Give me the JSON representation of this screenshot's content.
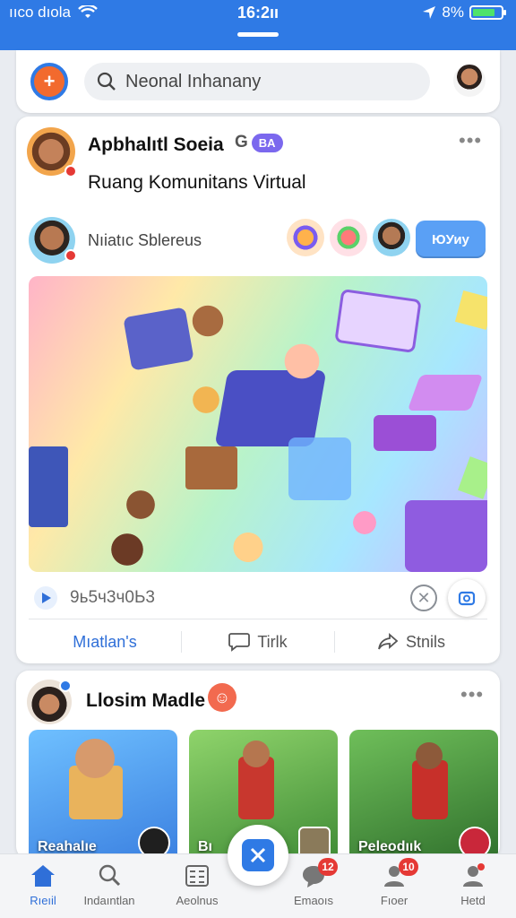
{
  "status_bar": {
    "carrier": "ııco dıola",
    "time": "16:2ıı",
    "battery": "8%"
  },
  "search": {
    "placeholder": "Neonal Inhanany"
  },
  "post": {
    "author": "Apbhalıtl Soeia",
    "badge": "BA",
    "subtitle": "Ruang Komunitans Virtual",
    "member_name": "Nıiatıc Sblereus",
    "follow_label": "ЮУиу",
    "count": "9ь5ч3ч0Ь3",
    "actions": [
      "Mıatlan's",
      "Tirlk",
      "Stnils"
    ]
  },
  "post2": {
    "author": "Llosim Madle",
    "thumbs": [
      "Reahalıe",
      "Bı",
      "Peleodıık"
    ]
  },
  "bottom_nav": {
    "items": [
      {
        "label": "Rıeıil",
        "icon": "home-icon",
        "badge": ""
      },
      {
        "label": "Indaıntlan",
        "icon": "search-people-icon",
        "badge": ""
      },
      {
        "label": "Aeolnus",
        "icon": "grid-icon",
        "badge": ""
      },
      {
        "label": "Emaoıs",
        "icon": "chat-icon",
        "badge": "12"
      },
      {
        "label": "Fıoer",
        "icon": "people-icon",
        "badge": "10"
      },
      {
        "label": "Hetd",
        "icon": "profile-icon",
        "badge": ""
      }
    ]
  },
  "colors": {
    "primary": "#2f7ae5",
    "accent": "#f26a2e",
    "badge": "#e53935"
  }
}
